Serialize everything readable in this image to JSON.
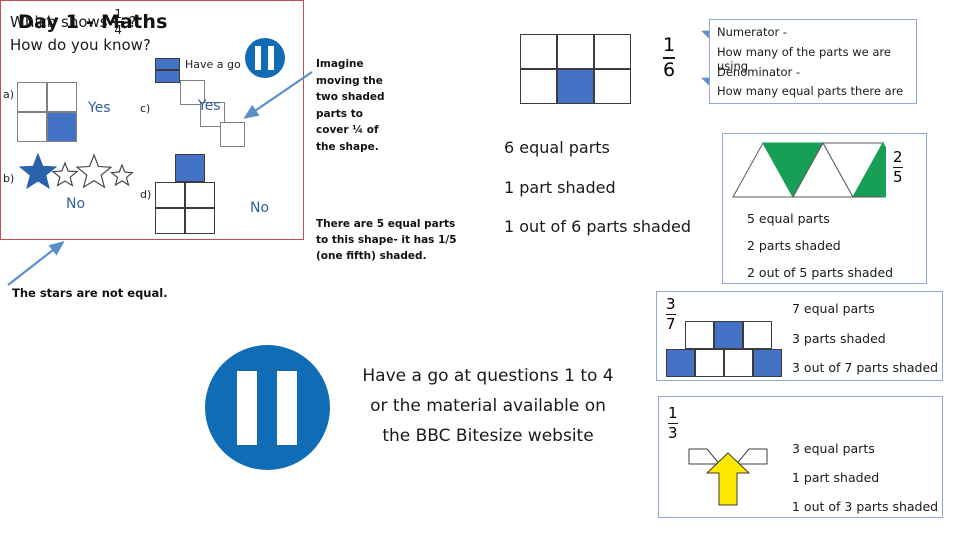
{
  "title": "Day 1 - Maths",
  "slide_panel": {
    "question_prefix": "Which shows",
    "question_fraction": {
      "num": "1",
      "den": "4"
    },
    "question_suffix": "?",
    "question2": "How do you know?",
    "have_a_go": "Have a go",
    "options": [
      {
        "key": "a)",
        "answer": "Yes"
      },
      {
        "key": "b)",
        "answer": "No"
      },
      {
        "key": "c)",
        "answer": "Yes"
      },
      {
        "key": "d)",
        "answer": "No"
      }
    ],
    "pause_icon": "pause-icon"
  },
  "stars_note": "The stars are not equal.",
  "notes": {
    "imagine": [
      "Imagine",
      "moving the",
      "two shaded",
      "parts to",
      "cover ¼ of",
      "the shape."
    ],
    "five_parts": [
      "There are 5 equal parts",
      "to this shape- it has 1/5",
      "(one fifth) shaded."
    ]
  },
  "six_parts": {
    "fraction": {
      "num": "1",
      "den": "6"
    },
    "lines": [
      "6 equal parts",
      "1 part shaded",
      "1 out of 6 parts shaded"
    ],
    "grid": {
      "cols": 3,
      "rows": 2,
      "shaded": [
        4
      ]
    }
  },
  "numerator_box": {
    "lines": [
      "Numerator -",
      "How many of the parts we are using",
      "Denominator -",
      "How many equal parts there are"
    ]
  },
  "triangles_box": {
    "fraction": {
      "num": "2",
      "den": "5"
    },
    "lines": [
      "5 equal parts",
      "2 parts shaded",
      "2 out of 5 parts shaded"
    ],
    "shaded_color": "#17a055",
    "shaded_indices": [
      1,
      4
    ]
  },
  "sevenths_box": {
    "fraction": {
      "num": "3",
      "den": "7"
    },
    "lines": [
      "7 equal parts",
      "3 parts shaded",
      "3 out of 7 parts shaded"
    ],
    "top_row_shaded": [
      1
    ],
    "bottom_row_shaded": [
      0,
      3
    ]
  },
  "thirds_box": {
    "fraction": {
      "num": "1",
      "den": "3"
    },
    "lines": [
      "3 equal parts",
      "1 part shaded",
      "1 out of 3 parts shaded"
    ],
    "shaded_color": "#ffe800"
  },
  "bbc": {
    "lines": [
      "Have a go at questions 1 to 4",
      "or the material available on",
      "the BBC Bitesize website"
    ],
    "pause_icon": "pause-icon"
  },
  "colors": {
    "blue_fill": "#4472c4",
    "pause_blue": "#0f6cb5",
    "green_fill": "#17a055",
    "yellow_fill": "#ffe800",
    "panel_border": "#c0504d",
    "box_border": "#8eaadb",
    "answer_blue": "#2e5f9e"
  }
}
